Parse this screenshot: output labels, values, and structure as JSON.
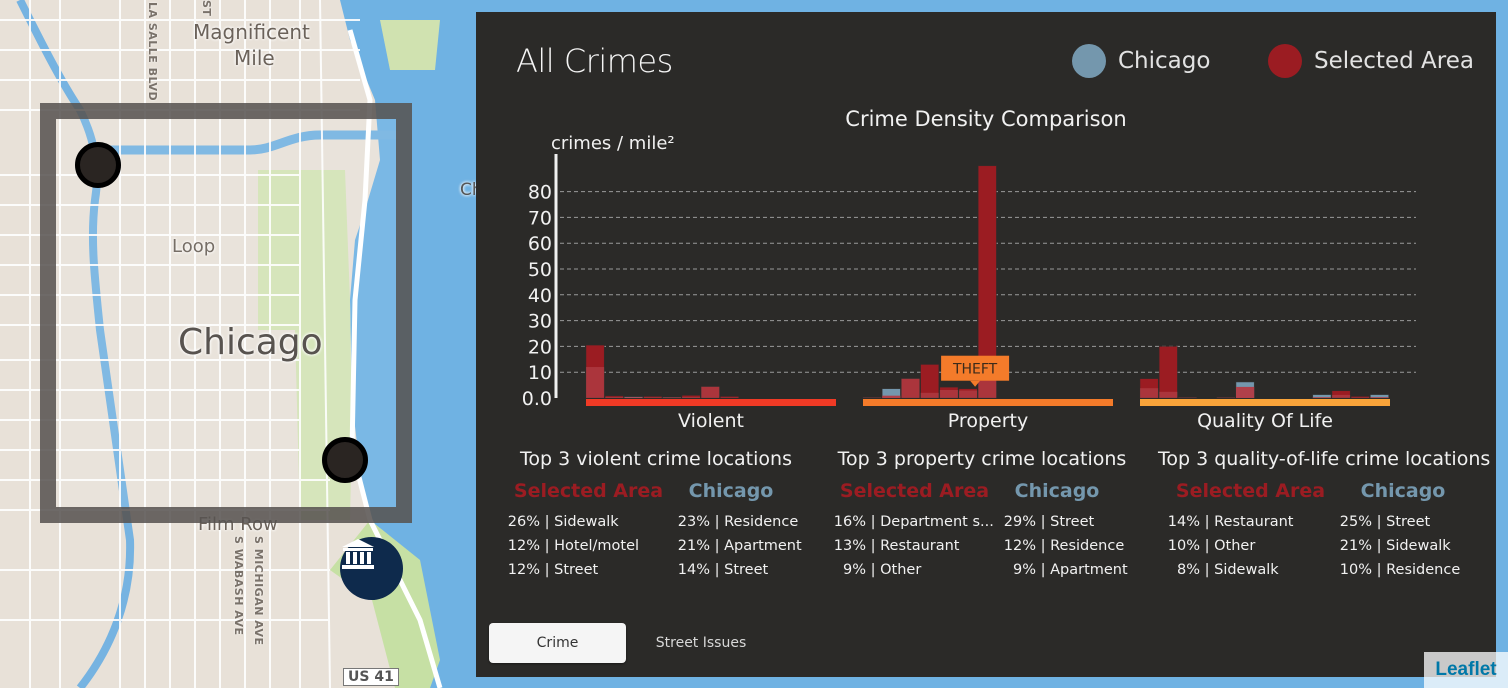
{
  "map": {
    "labels": {
      "magnificent_mile_line1": "Magnificent",
      "magnificent_mile_line2": "Mile",
      "loop": "Loop",
      "city": "Chicago",
      "film_row": "Film Row",
      "harbor": "Chicago Harbor",
      "la_salle": "LA SALLE BLVD",
      "st": "ST",
      "s_michigan": "S MICHIGAN AVE",
      "s_wabash": "S WABASH AVE",
      "us41": "US 41"
    },
    "attribution": "Leaflet",
    "markers": [
      {
        "type": "museum-icon"
      }
    ]
  },
  "panel": {
    "title": "All Crimes",
    "legend": [
      {
        "label": "Chicago",
        "color": "#7497ad"
      },
      {
        "label": "Selected Area",
        "color": "#9b1c22"
      }
    ],
    "top3": [
      {
        "title": "Top 3 violent crime locations",
        "selected_heading": "Selected Area",
        "chicago_heading": "Chicago",
        "selected": [
          {
            "pct": "26%",
            "loc": "Sidewalk"
          },
          {
            "pct": "12%",
            "loc": "Hotel/motel"
          },
          {
            "pct": "12%",
            "loc": "Street"
          }
        ],
        "chicago": [
          {
            "pct": "23%",
            "loc": "Residence"
          },
          {
            "pct": "21%",
            "loc": "Apartment"
          },
          {
            "pct": "14%",
            "loc": "Street"
          }
        ]
      },
      {
        "title": "Top 3 property crime locations",
        "selected_heading": "Selected Area",
        "chicago_heading": "Chicago",
        "selected": [
          {
            "pct": "16%",
            "loc": "Department s..."
          },
          {
            "pct": "13%",
            "loc": "Restaurant"
          },
          {
            "pct": "9%",
            "loc": "Other"
          }
        ],
        "chicago": [
          {
            "pct": "29%",
            "loc": "Street"
          },
          {
            "pct": "12%",
            "loc": "Residence"
          },
          {
            "pct": "9%",
            "loc": "Apartment"
          }
        ]
      },
      {
        "title": "Top 3 quality-of-life crime locations",
        "selected_heading": "Selected Area",
        "chicago_heading": "Chicago",
        "selected": [
          {
            "pct": "14%",
            "loc": "Restaurant"
          },
          {
            "pct": "10%",
            "loc": "Other"
          },
          {
            "pct": "8%",
            "loc": "Sidewalk"
          }
        ],
        "chicago": [
          {
            "pct": "25%",
            "loc": "Street"
          },
          {
            "pct": "21%",
            "loc": "Sidewalk"
          },
          {
            "pct": "10%",
            "loc": "Residence"
          }
        ]
      }
    ],
    "tabs": [
      {
        "label": "Crime",
        "active": true
      },
      {
        "label": "Street Issues",
        "active": false
      }
    ]
  },
  "chart_data": {
    "type": "bar",
    "title": "Crime Density Comparison",
    "ylabel": "crimes / mile²",
    "xlabel": "",
    "ylim": [
      0,
      88
    ],
    "yticks": [
      0,
      10,
      20,
      30,
      40,
      50,
      60,
      70,
      80
    ],
    "ytick_labels": [
      "0.0",
      "10",
      "20",
      "30",
      "40",
      "50",
      "60",
      "70",
      "80"
    ],
    "grid": true,
    "tooltip": {
      "label": "THEFT",
      "group": "Property",
      "index": 5,
      "color": "#f47b2a"
    },
    "series_colors": {
      "Selected Area": "#9b1c22",
      "Chicago": "#7497ad"
    },
    "groups": [
      {
        "name": "Violent",
        "color": "#f03a25",
        "selected": [
          20.5,
          0.8,
          0.3,
          0.6,
          0.2,
          1.0,
          4.4,
          0.6,
          0,
          0,
          0,
          0,
          0
        ],
        "chicago": [
          12.0,
          0.4,
          0.5,
          0.3,
          0.3,
          0.4,
          4.4,
          0.2,
          0,
          0,
          0,
          0,
          0
        ]
      },
      {
        "name": "Property",
        "color": "#f47b2a",
        "selected": [
          0.2,
          0.9,
          7.5,
          13.0,
          4.2,
          3.6,
          90.0,
          0,
          0,
          0,
          0,
          0,
          0
        ],
        "chicago": [
          0.2,
          3.6,
          7.5,
          2.0,
          3.1,
          2.9,
          14.5,
          0,
          0,
          0,
          0,
          0,
          0
        ]
      },
      {
        "name": "Quality Of Life",
        "color": "#f9a43a",
        "selected": [
          7.5,
          20.0,
          0.2,
          0,
          0.2,
          4.3,
          0,
          0,
          0,
          0.3,
          2.8,
          0.6,
          0.3
        ],
        "chicago": [
          3.8,
          2.4,
          0.2,
          0,
          0.2,
          6.2,
          0,
          0,
          0,
          1.3,
          1.2,
          0.2,
          1.3
        ]
      }
    ]
  }
}
